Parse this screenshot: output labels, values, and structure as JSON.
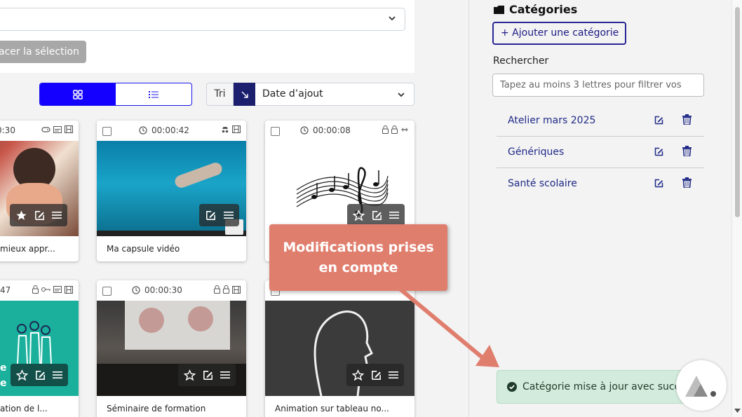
{
  "toolbar": {
    "clear_selection_label": "acer la sélection",
    "sort_label": "Tri",
    "sort_value": "Date d’ajout"
  },
  "cards": [
    {
      "duration": "0:30",
      "title": "mieux appr..."
    },
    {
      "duration": "00:00:42",
      "title": "Ma capsule vidéo"
    },
    {
      "duration": "00:00:08",
      "title": ""
    },
    {
      "duration": "47",
      "title": "ation de l..."
    },
    {
      "duration": "00:00:30",
      "title": "Séminaire de formation"
    },
    {
      "duration": "",
      "title": "Animation sur tableau no..."
    }
  ],
  "sidebar": {
    "title": "Catégories",
    "add_label": "+ Ajouter une catégorie",
    "search_label": "Rechercher",
    "search_placeholder": "Tapez au moins 3 lettres pour filtrer vos",
    "categories": [
      {
        "name": "Atelier mars 2025"
      },
      {
        "name": "Génériques"
      },
      {
        "name": "Santé scolaire"
      }
    ]
  },
  "toast": {
    "message": "Catégorie mise à jour avec succ"
  },
  "annotation": {
    "text": "Modifications prises en compte"
  },
  "colors": {
    "accent": "#1400ff",
    "brand_dark": "#1f2a86",
    "callout": "#e07e6e",
    "toast_bg": "#d3ebdc"
  }
}
